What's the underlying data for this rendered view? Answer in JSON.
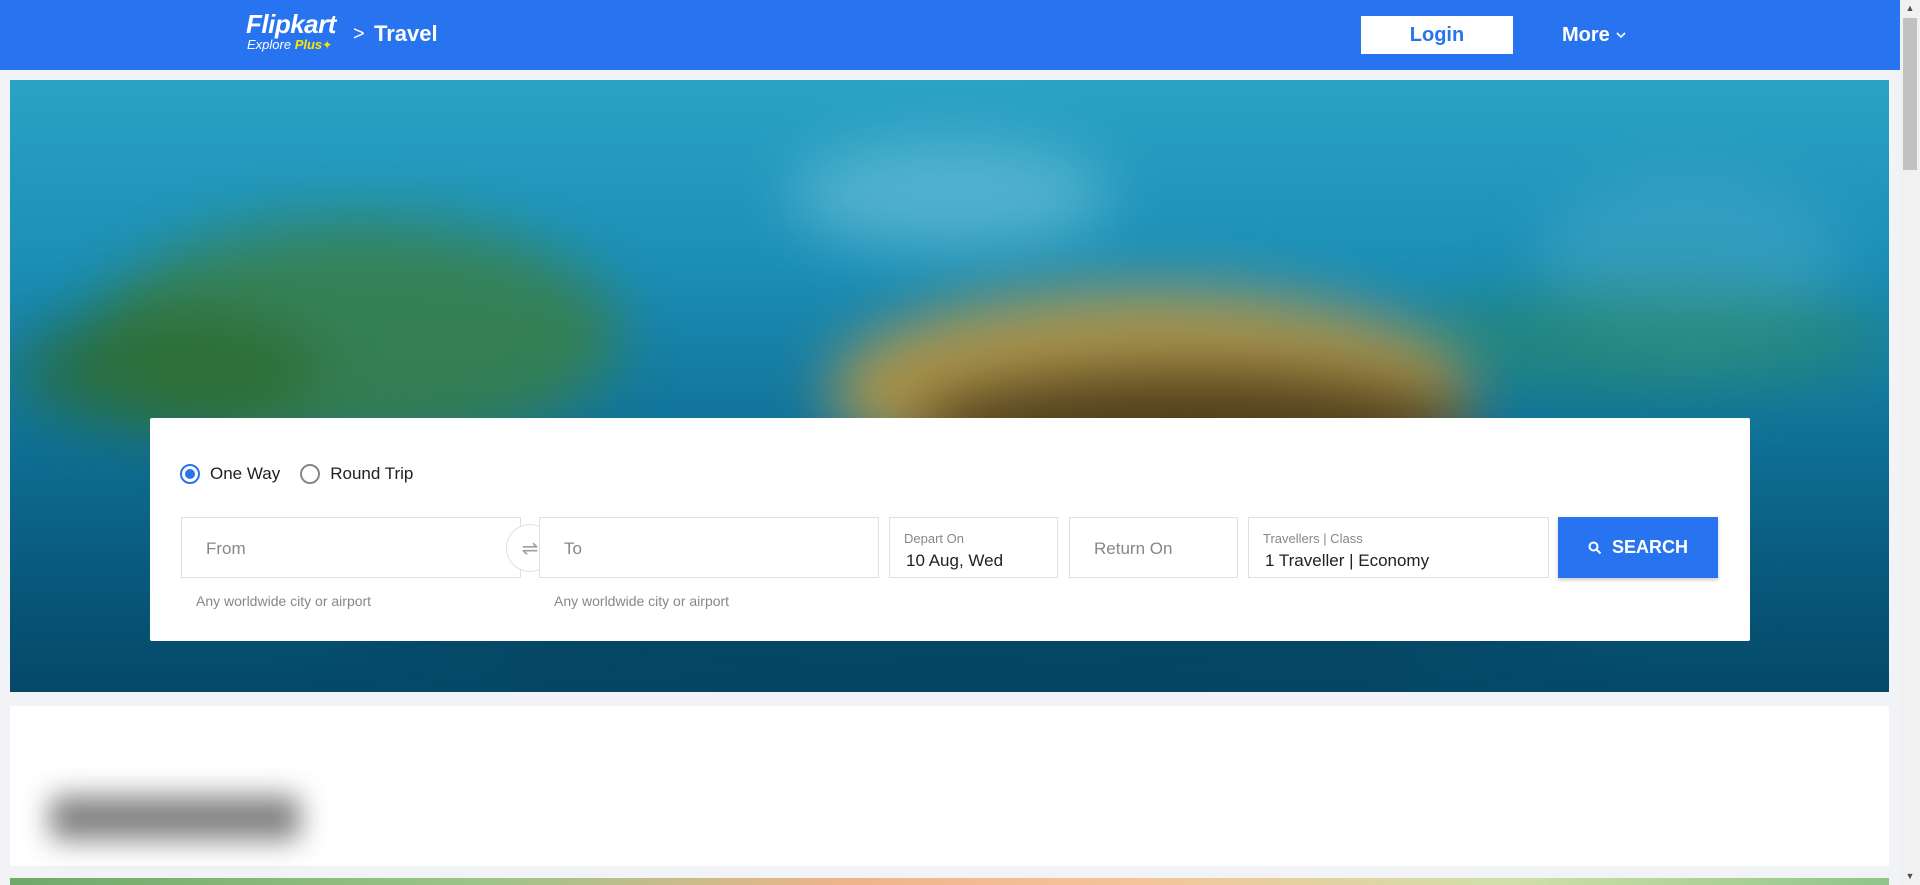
{
  "header": {
    "logo_text": "Flipkart",
    "logo_sub_explore": "Explore",
    "logo_sub_plus": "Plus",
    "breadcrumb_chevron": ">",
    "breadcrumb_current": "Travel",
    "login_label": "Login",
    "more_label": "More",
    "more_chevron": "⌄",
    "brand_color": "#2874f0"
  },
  "search": {
    "trip_types": [
      {
        "label": "One Way",
        "selected": true
      },
      {
        "label": "Round Trip",
        "selected": false
      }
    ],
    "from": {
      "placeholder": "From",
      "hint": "Any worldwide city or airport"
    },
    "swap_icon": "⇌",
    "to": {
      "placeholder": "To",
      "hint": "Any worldwide city or airport"
    },
    "depart": {
      "label": "Depart On",
      "value": "10 Aug, Wed"
    },
    "return": {
      "placeholder": "Return On"
    },
    "travellers": {
      "label": "Travellers | Class",
      "value": "1 Traveller | Economy"
    },
    "search_label": "SEARCH",
    "search_icon": "search-icon"
  },
  "scrollbar": {
    "up": "▲",
    "down": "▼"
  }
}
